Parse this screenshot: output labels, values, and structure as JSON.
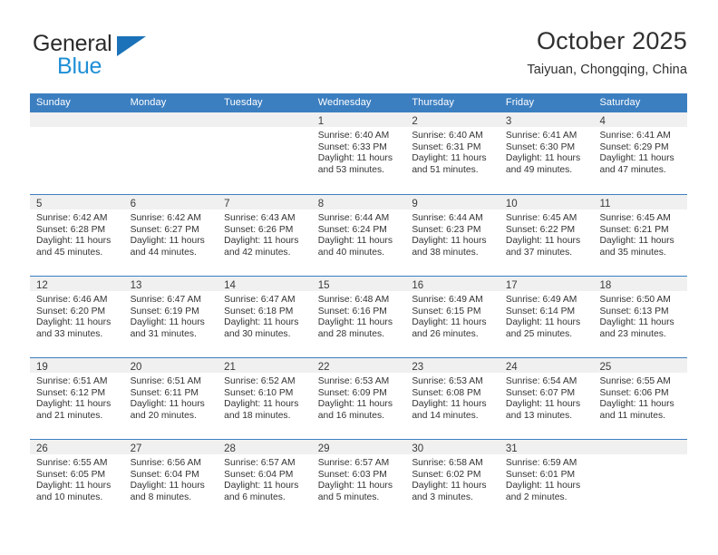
{
  "brand": {
    "name_part1": "General",
    "name_part2": "Blue",
    "logo_accent_color": "#1b72b8",
    "logo_text_color": "#1f8fd6",
    "triangle_icon": "triangle-icon"
  },
  "header": {
    "title": "October 2025",
    "subtitle": "Taiyuan, Chongqing, China"
  },
  "colors": {
    "header_bar": "#3c7fc1",
    "daynum_strip": "#f0f0f0",
    "text": "#333333"
  },
  "calendar": {
    "weekdays": [
      "Sunday",
      "Monday",
      "Tuesday",
      "Wednesday",
      "Thursday",
      "Friday",
      "Saturday"
    ],
    "weeks": [
      [
        {
          "day": "",
          "detail": ""
        },
        {
          "day": "",
          "detail": ""
        },
        {
          "day": "",
          "detail": ""
        },
        {
          "day": "1",
          "detail": "Sunrise: 6:40 AM\nSunset: 6:33 PM\nDaylight: 11 hours\nand 53 minutes."
        },
        {
          "day": "2",
          "detail": "Sunrise: 6:40 AM\nSunset: 6:31 PM\nDaylight: 11 hours\nand 51 minutes."
        },
        {
          "day": "3",
          "detail": "Sunrise: 6:41 AM\nSunset: 6:30 PM\nDaylight: 11 hours\nand 49 minutes."
        },
        {
          "day": "4",
          "detail": "Sunrise: 6:41 AM\nSunset: 6:29 PM\nDaylight: 11 hours\nand 47 minutes."
        }
      ],
      [
        {
          "day": "5",
          "detail": "Sunrise: 6:42 AM\nSunset: 6:28 PM\nDaylight: 11 hours\nand 45 minutes."
        },
        {
          "day": "6",
          "detail": "Sunrise: 6:42 AM\nSunset: 6:27 PM\nDaylight: 11 hours\nand 44 minutes."
        },
        {
          "day": "7",
          "detail": "Sunrise: 6:43 AM\nSunset: 6:26 PM\nDaylight: 11 hours\nand 42 minutes."
        },
        {
          "day": "8",
          "detail": "Sunrise: 6:44 AM\nSunset: 6:24 PM\nDaylight: 11 hours\nand 40 minutes."
        },
        {
          "day": "9",
          "detail": "Sunrise: 6:44 AM\nSunset: 6:23 PM\nDaylight: 11 hours\nand 38 minutes."
        },
        {
          "day": "10",
          "detail": "Sunrise: 6:45 AM\nSunset: 6:22 PM\nDaylight: 11 hours\nand 37 minutes."
        },
        {
          "day": "11",
          "detail": "Sunrise: 6:45 AM\nSunset: 6:21 PM\nDaylight: 11 hours\nand 35 minutes."
        }
      ],
      [
        {
          "day": "12",
          "detail": "Sunrise: 6:46 AM\nSunset: 6:20 PM\nDaylight: 11 hours\nand 33 minutes."
        },
        {
          "day": "13",
          "detail": "Sunrise: 6:47 AM\nSunset: 6:19 PM\nDaylight: 11 hours\nand 31 minutes."
        },
        {
          "day": "14",
          "detail": "Sunrise: 6:47 AM\nSunset: 6:18 PM\nDaylight: 11 hours\nand 30 minutes."
        },
        {
          "day": "15",
          "detail": "Sunrise: 6:48 AM\nSunset: 6:16 PM\nDaylight: 11 hours\nand 28 minutes."
        },
        {
          "day": "16",
          "detail": "Sunrise: 6:49 AM\nSunset: 6:15 PM\nDaylight: 11 hours\nand 26 minutes."
        },
        {
          "day": "17",
          "detail": "Sunrise: 6:49 AM\nSunset: 6:14 PM\nDaylight: 11 hours\nand 25 minutes."
        },
        {
          "day": "18",
          "detail": "Sunrise: 6:50 AM\nSunset: 6:13 PM\nDaylight: 11 hours\nand 23 minutes."
        }
      ],
      [
        {
          "day": "19",
          "detail": "Sunrise: 6:51 AM\nSunset: 6:12 PM\nDaylight: 11 hours\nand 21 minutes."
        },
        {
          "day": "20",
          "detail": "Sunrise: 6:51 AM\nSunset: 6:11 PM\nDaylight: 11 hours\nand 20 minutes."
        },
        {
          "day": "21",
          "detail": "Sunrise: 6:52 AM\nSunset: 6:10 PM\nDaylight: 11 hours\nand 18 minutes."
        },
        {
          "day": "22",
          "detail": "Sunrise: 6:53 AM\nSunset: 6:09 PM\nDaylight: 11 hours\nand 16 minutes."
        },
        {
          "day": "23",
          "detail": "Sunrise: 6:53 AM\nSunset: 6:08 PM\nDaylight: 11 hours\nand 14 minutes."
        },
        {
          "day": "24",
          "detail": "Sunrise: 6:54 AM\nSunset: 6:07 PM\nDaylight: 11 hours\nand 13 minutes."
        },
        {
          "day": "25",
          "detail": "Sunrise: 6:55 AM\nSunset: 6:06 PM\nDaylight: 11 hours\nand 11 minutes."
        }
      ],
      [
        {
          "day": "26",
          "detail": "Sunrise: 6:55 AM\nSunset: 6:05 PM\nDaylight: 11 hours\nand 10 minutes."
        },
        {
          "day": "27",
          "detail": "Sunrise: 6:56 AM\nSunset: 6:04 PM\nDaylight: 11 hours\nand 8 minutes."
        },
        {
          "day": "28",
          "detail": "Sunrise: 6:57 AM\nSunset: 6:04 PM\nDaylight: 11 hours\nand 6 minutes."
        },
        {
          "day": "29",
          "detail": "Sunrise: 6:57 AM\nSunset: 6:03 PM\nDaylight: 11 hours\nand 5 minutes."
        },
        {
          "day": "30",
          "detail": "Sunrise: 6:58 AM\nSunset: 6:02 PM\nDaylight: 11 hours\nand 3 minutes."
        },
        {
          "day": "31",
          "detail": "Sunrise: 6:59 AM\nSunset: 6:01 PM\nDaylight: 11 hours\nand 2 minutes."
        },
        {
          "day": "",
          "detail": ""
        }
      ]
    ]
  }
}
